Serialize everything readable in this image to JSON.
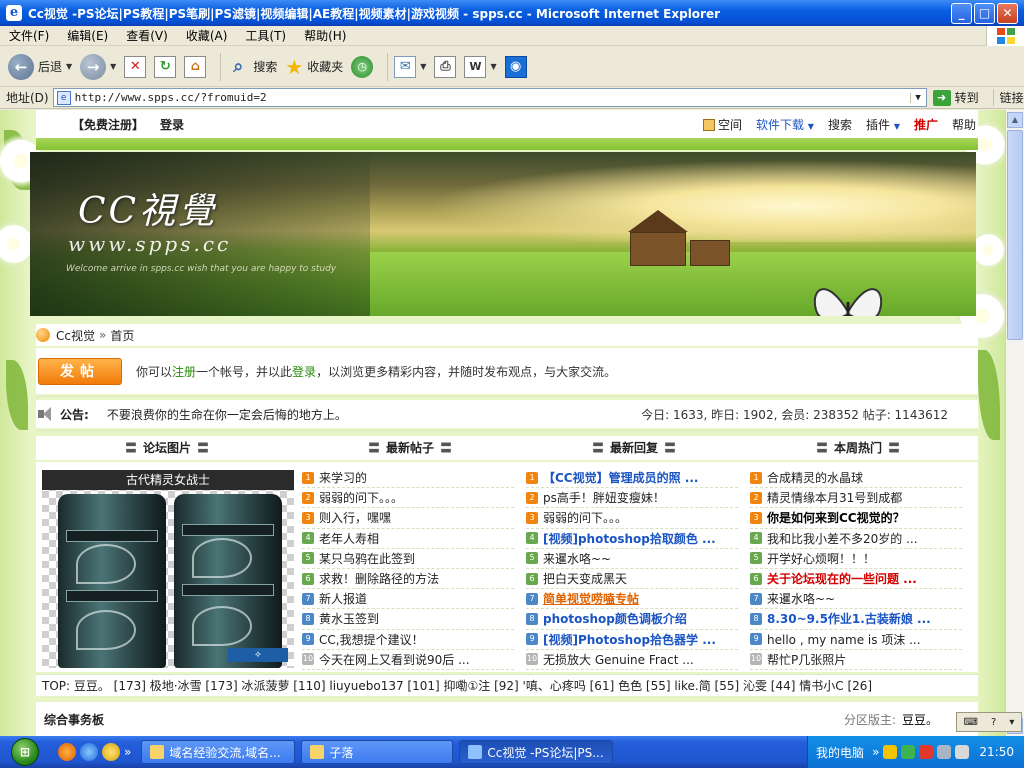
{
  "window": {
    "title": "Cc视觉 -PS论坛|PS教程|PS笔刷|PS滤镜|视频编辑|AE教程|视频素材|游戏视频 - spps.cc - Microsoft Internet Explorer"
  },
  "menu": [
    "文件(F)",
    "编辑(E)",
    "查看(V)",
    "收藏(A)",
    "工具(T)",
    "帮助(H)"
  ],
  "toolbar": {
    "back": "后退",
    "search": "搜索",
    "favorites": "收藏夹"
  },
  "address": {
    "label": "地址(D)",
    "url": "http://www.spps.cc/?fromuid=2",
    "go": "转到",
    "links": "链接"
  },
  "site_nav": {
    "register": "【免费注册】",
    "login": "登录",
    "space": "空间",
    "software": "软件下载",
    "search": "搜索",
    "plugins": "插件",
    "promote": "推广",
    "help": "帮助"
  },
  "banner": {
    "logo": "CC視覺",
    "url": "www.spps.cc",
    "tagline": "Welcome arrive in spps.cc  wish that you are happy to study"
  },
  "breadcrumb": {
    "home": "Cc视觉",
    "current": "首页"
  },
  "post_row": {
    "button": "发帖",
    "notice_pre": "你可以",
    "register": "注册",
    "notice_mid": "一个帐号，并以此",
    "login": "登录",
    "notice_post": "，以浏览更多精彩内容，并随时发布观点，与大家交流。"
  },
  "announcement": {
    "label": "公告:",
    "text": "不要浪费你的生命在你一定会后悔的地方上。",
    "stats": "今日: 1633, 昨日: 1902, 会员: 238352 帖子: 1143612"
  },
  "columns": [
    "论坛图片",
    "最新帖子",
    "最新回复",
    "本周热门"
  ],
  "image_caption": "古代精灵女战士",
  "latest_posts": [
    {
      "n": "1",
      "t": "来学习的"
    },
    {
      "n": "2",
      "t": "弱弱的问下。。。"
    },
    {
      "n": "3",
      "t": "则入行，嘿嘿"
    },
    {
      "n": "4",
      "t": "老年人寿相"
    },
    {
      "n": "5",
      "t": "某只乌鸦在此签到"
    },
    {
      "n": "6",
      "t": "求救！删除路径的方法"
    },
    {
      "n": "7",
      "t": "新人报道"
    },
    {
      "n": "8",
      "t": "黄水玉签到"
    },
    {
      "n": "9",
      "t": "CC,我想提个建议！"
    },
    {
      "n": "10",
      "t": "今天在网上又看到说90后 ..."
    }
  ],
  "latest_replies": [
    {
      "n": "1",
      "t": "【CC视觉】管理成员的照 ...",
      "style": "blue"
    },
    {
      "n": "2",
      "t": "ps高手！胖妞变瘦妹！",
      "style": ""
    },
    {
      "n": "3",
      "t": "弱弱的问下。。。",
      "style": ""
    },
    {
      "n": "4",
      "t": "[视频]photoshop拾取颜色 ...",
      "style": "blue"
    },
    {
      "n": "5",
      "t": "来暹水咯~~",
      "style": ""
    },
    {
      "n": "6",
      "t": "把白天变成黑天",
      "style": ""
    },
    {
      "n": "7",
      "t": "简单视觉唠嗑专帖",
      "style": "orange"
    },
    {
      "n": "8",
      "t": "photoshop颜色调板介绍",
      "style": "blue"
    },
    {
      "n": "9",
      "t": "[视频]Photoshop拾色器学 ...",
      "style": "blue"
    },
    {
      "n": "10",
      "t": "无损放大 Genuine Fract ...",
      "style": ""
    }
  ],
  "hot_week": [
    {
      "n": "1",
      "t": "合成精灵的水晶球",
      "style": ""
    },
    {
      "n": "2",
      "t": "精灵情缘本月31号到成都",
      "style": ""
    },
    {
      "n": "3",
      "t": "你是如何来到CC视觉的？",
      "style": "bold"
    },
    {
      "n": "4",
      "t": "我和比我小差不多20岁的 ...",
      "style": ""
    },
    {
      "n": "5",
      "t": "开学好心烦啊！！！",
      "style": ""
    },
    {
      "n": "6",
      "t": "关于论坛现在的一些问题 ...",
      "style": "red"
    },
    {
      "n": "7",
      "t": "来暹水咯~~",
      "style": ""
    },
    {
      "n": "8",
      "t": "8.30~9.5作业1.古装新娘 ...",
      "style": "blue"
    },
    {
      "n": "9",
      "t": "hello , my name is 项沫 ...",
      "style": ""
    },
    {
      "n": "10",
      "t": "帮忙P几张照片",
      "style": ""
    }
  ],
  "top_row": "TOP: 豆豆。 [173] 极地·冰雪 [173] 冰派菠萝 [110] liuyuebo137 [101] 抑嘞①注 [92] '嗔、心疼吗 [61] 色色 [55] like.简 [55] 沁雯 [44] 情书小C [26]",
  "bottom": {
    "left": "综合事务板",
    "mod_label": "分区版主:",
    "mod": "豆豆。"
  },
  "taskbar": {
    "tasks": [
      "域名经验交流,域名...",
      "子落",
      "Cc视觉 -PS论坛|PS..."
    ],
    "tray_label": "我的电脑",
    "clock": "21:50"
  }
}
